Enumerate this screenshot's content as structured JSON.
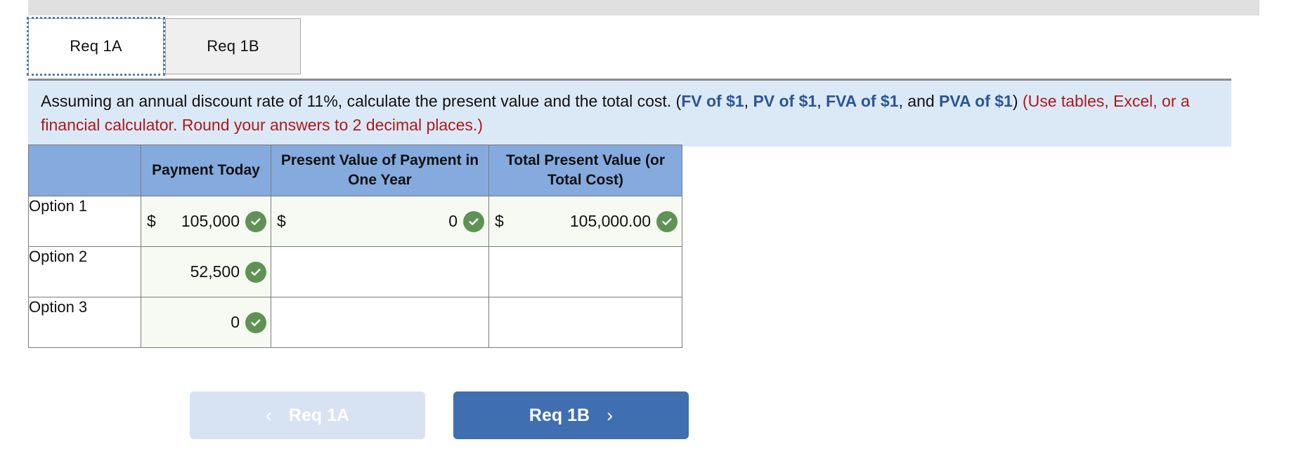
{
  "tabs": [
    {
      "label": "Req 1A",
      "active": true
    },
    {
      "label": "Req 1B",
      "active": false
    }
  ],
  "instruction": {
    "part1": "Assuming an annual discount rate of 11%, calculate the present value and the total cost. (",
    "link1": "FV of $1",
    "sep1": ", ",
    "link2": "PV of $1",
    "sep2": ", ",
    "link3": "FVA of $1",
    "sep3": ", and ",
    "link4": "PVA of $1",
    "close_paren": ") ",
    "note": "(Use tables, Excel, or a financial calculator. Round your answers to 2 decimal places.)"
  },
  "table": {
    "headers": [
      "",
      "Payment Today",
      "Present Value of Payment in One Year",
      "Total Present Value (or Total Cost)"
    ],
    "rows": [
      {
        "label": "Option 1",
        "payment_today": {
          "currency": "$",
          "value": "105,000",
          "checked": true,
          "filled": true
        },
        "pv_one_year": {
          "currency": "$",
          "value": "0",
          "checked": true,
          "filled": true
        },
        "total_pv": {
          "currency": "$",
          "value": "105,000.00",
          "checked": true,
          "filled": true
        }
      },
      {
        "label": "Option 2",
        "payment_today": {
          "currency": "",
          "value": "52,500",
          "checked": true,
          "filled": true
        },
        "pv_one_year": {
          "currency": "",
          "value": "",
          "checked": false,
          "filled": false
        },
        "total_pv": {
          "currency": "",
          "value": "",
          "checked": false,
          "filled": false
        }
      },
      {
        "label": "Option 3",
        "payment_today": {
          "currency": "",
          "value": "0",
          "checked": true,
          "filled": true
        },
        "pv_one_year": {
          "currency": "",
          "value": "",
          "checked": false,
          "filled": false
        },
        "total_pv": {
          "currency": "",
          "value": "",
          "checked": false,
          "filled": false
        }
      }
    ]
  },
  "nav": {
    "prev_label": "Req 1A",
    "prev_chevron": "‹",
    "next_label": "Req 1B",
    "next_chevron": "›"
  },
  "colors": {
    "header_blue": "#85aade",
    "banner_blue": "#dbe9f7",
    "link_blue": "#2b5597",
    "note_red": "#b01818",
    "check_green": "#5f9254",
    "next_button": "#3f6fb0",
    "prev_button": "#d7e3f2"
  }
}
